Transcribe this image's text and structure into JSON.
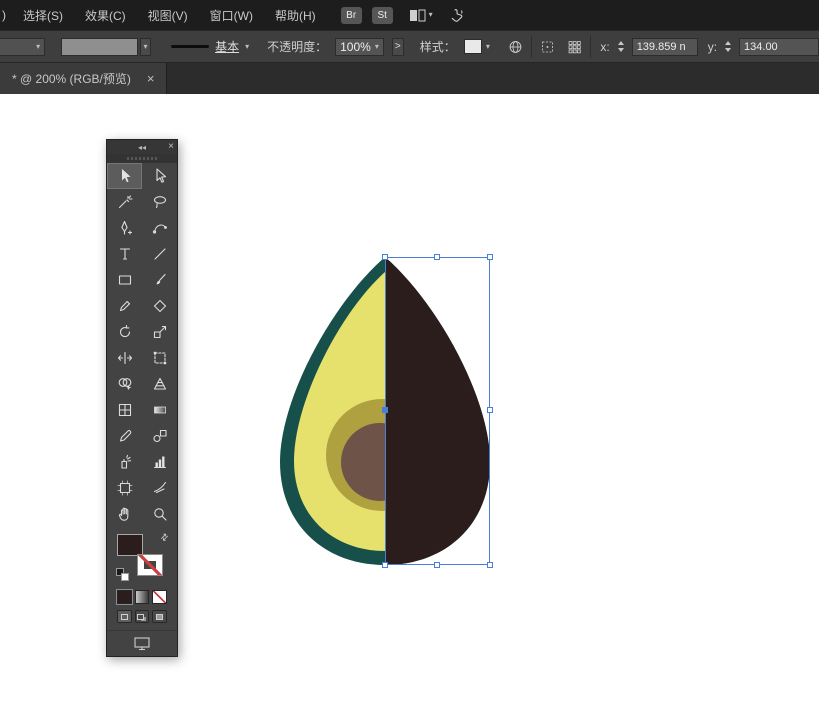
{
  "colors": {
    "selection_blue": "#4a7fd8",
    "avocado_skin": "#17504a",
    "avocado_flesh": "#e5e16c",
    "avocado_ring": "#b0a140",
    "avocado_pit": "#6e5348",
    "avocado_half": "#2a1d1b"
  },
  "menu_bar": {
    "clipped_item": ")",
    "items": [
      "选择(S)",
      "效果(C)",
      "视图(V)",
      "窗口(W)",
      "帮助(H)"
    ],
    "bridge_badge": "Br",
    "stock_badge": "St",
    "icons": [
      "workspace-switcher-icon",
      "chevron-down-icon",
      "touch-workspace-icon"
    ]
  },
  "control_bar": {
    "stroke_preset": "基本",
    "opacity_label": "不透明度：",
    "opacity_value": "100%",
    "more_options": ">",
    "style_label": "样式：",
    "x_label": "x:",
    "x_value": "139.859 n",
    "y_label": "y:",
    "y_value": "134.00",
    "icons": [
      "globe-icon",
      "bounding-box-icon",
      "grid-icon"
    ]
  },
  "document_tab": {
    "title": "* @ 200% (RGB/预览)",
    "close": "×"
  },
  "tools_panel": {
    "collapse_icon": "◂◂",
    "close_icon": "×",
    "active_tool": "selection",
    "fill_color": "#2a1d1b",
    "stroke_style": "none",
    "tools": [
      "selection",
      "direct-selection",
      "magic-wand",
      "lasso",
      "pen",
      "curvature",
      "type",
      "line-segment",
      "rectangle",
      "paintbrush",
      "pencil",
      "eraser",
      "rotate",
      "scale",
      "width",
      "free-transform",
      "shape-builder",
      "perspective-grid",
      "mesh",
      "gradient",
      "eyedropper",
      "blend",
      "symbol-sprayer",
      "column-graph",
      "artboard",
      "slice",
      "hand",
      "zoom"
    ],
    "controls": [
      "fill-swatch",
      "stroke-swatch",
      "swap-colors",
      "default-colors",
      "color-button",
      "gradient-button",
      "none-button",
      "draw-normal",
      "draw-behind",
      "draw-inside",
      "screen-mode"
    ]
  }
}
